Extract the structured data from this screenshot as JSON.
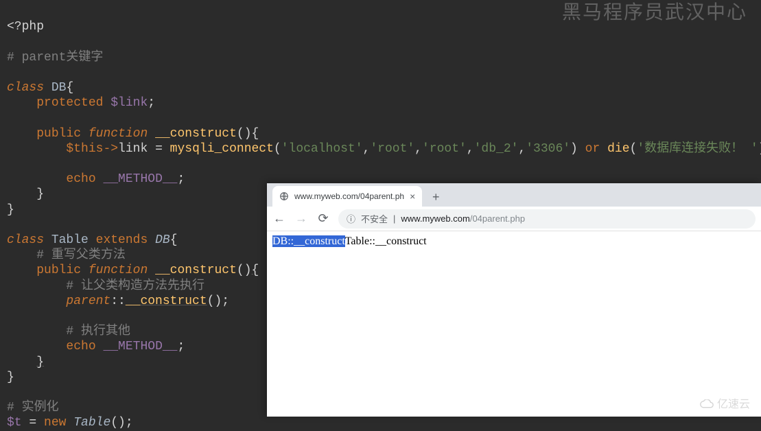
{
  "watermark_top": "黑马程序员武汉中心",
  "watermark_bottom": "亿速云",
  "code": {
    "open_tag": "<?php",
    "c_parent": "# parent关键字",
    "kw_class": "class",
    "cls_db": "DB",
    "brace_open": "{",
    "kw_protected": "protected",
    "var_link": "$link",
    "semi": ";",
    "kw_public": "public",
    "kw_function": "function",
    "fn_construct": "__construct",
    "parens": "()",
    "var_this": "$this",
    "arrow": "->",
    "prop_link": "link",
    "eq": " = ",
    "fn_mysqli": "mysqli_connect",
    "args_open": "(",
    "s_localhost": "'localhost'",
    "comma": ",",
    "s_root1": "'root'",
    "s_root2": "'root'",
    "s_db2": "'db_2'",
    "s_port": "'3306'",
    "args_close": ")",
    "kw_or": "or",
    "fn_die": "die",
    "s_die": "'数据库连接失败！ '",
    "kw_echo": "echo",
    "magic_method": "__METHOD__",
    "brace_close": "}",
    "cls_table": "Table",
    "kw_extends": "extends",
    "c_override": "# 重写父类方法",
    "c_letparent": "# 让父类构造方法先执行",
    "kw_parent": "parent",
    "dcolon": "::",
    "c_other": "# 执行其他",
    "c_inst": "# 实例化",
    "var_t": "$t",
    "kw_new": "new"
  },
  "browser": {
    "tab_title": "www.myweb.com/04parent.ph",
    "insecure_label": "不安全",
    "url_host": "www.myweb.com",
    "url_path": "/04parent.php",
    "page_selected": "DB::__construct",
    "page_rest": "Table::__construct"
  }
}
